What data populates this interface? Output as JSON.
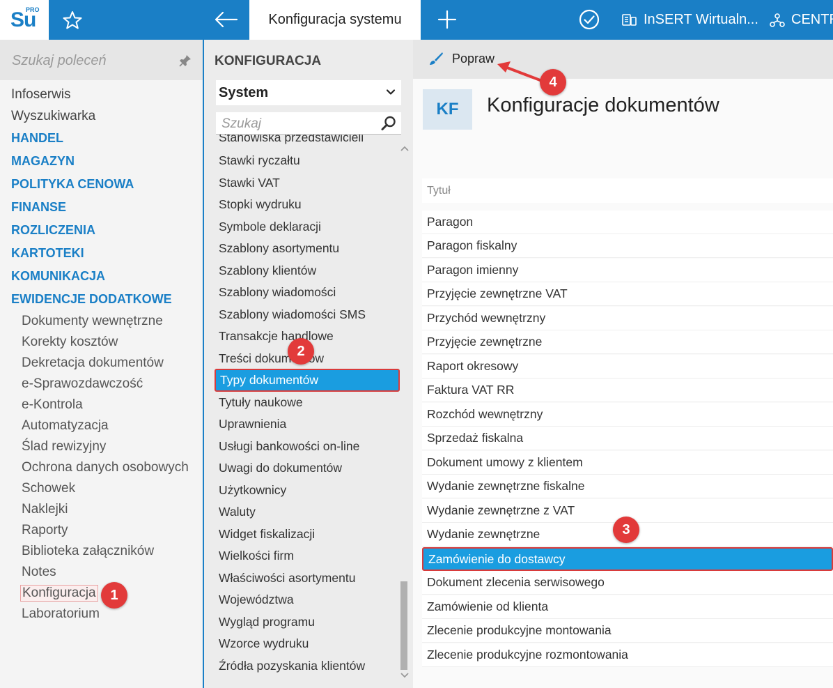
{
  "topbar": {
    "logo_text": "Su",
    "logo_badge": "PRO",
    "active_tab": "Konfiguracja systemu",
    "virtual_label": "InSERT Wirtualn...",
    "central_label": "CENTR"
  },
  "left_panel": {
    "search_placeholder": "Szukaj poleceń",
    "items": [
      "Infoserwis",
      "Wyszukiwarka"
    ],
    "categories": [
      "HANDEL",
      "MAGAZYN",
      "POLITYKA CENOWA",
      "FINANSE",
      "ROZLICZENIA",
      "KARTOTEKI",
      "KOMUNIKACJA",
      "EWIDENCJE DODATKOWE"
    ],
    "subitems": [
      "Dokumenty wewnętrzne",
      "Korekty kosztów",
      "Dekretacja dokumentów",
      "e-Sprawozdawczość",
      "e-Kontrola",
      "Automatyzacja",
      "Ślad rewizyjny",
      "Ochrona danych osobowych",
      "Schowek",
      "Naklejki",
      "Raporty",
      "Biblioteka załączników",
      "Notes",
      "Konfiguracja",
      "Laboratorium"
    ]
  },
  "middle_panel": {
    "title": "KONFIGURACJA",
    "select_value": "System",
    "search_placeholder": "Szukaj",
    "items": [
      "Stanowiska przedstawicieli",
      "Stawki ryczałtu",
      "Stawki VAT",
      "Stopki wydruku",
      "Symbole deklaracji",
      "Szablony asortymentu",
      "Szablony klientów",
      "Szablony wiadomości",
      "Szablony wiadomości SMS",
      "Transakcje handlowe",
      "Treści dokumentów",
      "Typy dokumentów",
      "Tytuły naukowe",
      "Uprawnienia",
      "Usługi bankowości on-line",
      "Uwagi do dokumentów",
      "Użytkownicy",
      "Waluty",
      "Widget fiskalizacji",
      "Wielkości firm",
      "Właściwości asortymentu",
      "Województwa",
      "Wygląd programu",
      "Wzorce wydruku",
      "Źródła pozyskania klientów"
    ]
  },
  "right_panel": {
    "toolbar_popraw": "Popraw",
    "badge": "KF",
    "title": "Konfiguracje dokumentów",
    "column_header": "Tytuł",
    "rows": [
      "Paragon",
      "Paragon fiskalny",
      "Paragon imienny",
      "Przyjęcie zewnętrzne VAT",
      "Przychód wewnętrzny",
      "Przyjęcie zewnętrzne",
      "Raport okresowy",
      "Faktura VAT RR",
      "Rozchód wewnętrzny",
      "Sprzedaż fiskalna",
      "Dokument umowy z klientem",
      "Wydanie zewnętrzne fiskalne",
      "Wydanie zewnętrzne z VAT",
      "Wydanie zewnętrzne",
      "Zamówienie do dostawcy",
      "Dokument zlecenia serwisowego",
      "Zamówienie od klienta",
      "Zlecenie produkcyjne montowania",
      "Zlecenie produkcyjne rozmontowania"
    ]
  },
  "annotations": [
    "1",
    "2",
    "3",
    "4"
  ],
  "colors": {
    "accent": "#1a7fc6",
    "selected": "#1a9de0",
    "annotation": "#e23a3a"
  }
}
